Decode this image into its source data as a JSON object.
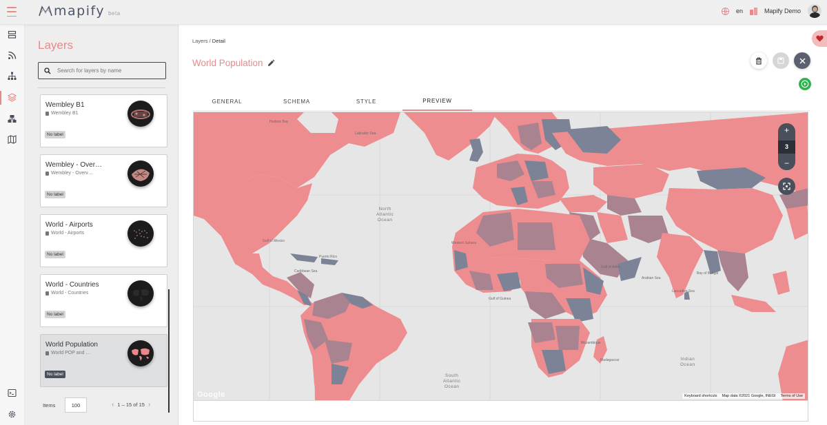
{
  "app": {
    "logo_text": "mapify",
    "logo_badge": "beta",
    "language": "en",
    "org_name": "Mapify Demo"
  },
  "rail": {
    "icons": [
      "datasets-icon",
      "rss-icon",
      "hierarchy-icon",
      "layers-icon",
      "sitemap-icon",
      "map-icon",
      "terminal-icon",
      "settings-icon"
    ],
    "active": "layers-icon"
  },
  "layers_panel": {
    "title": "Layers",
    "search_placeholder": "Search for layers by name",
    "cards": [
      {
        "title": "Wembley B1",
        "source": "Wembley B1",
        "label": "No label"
      },
      {
        "title": "Wembley - Over…",
        "source": "Wembley - Overv…",
        "label": "No label"
      },
      {
        "title": "World - Airports",
        "source": "World - Airports",
        "label": "No label"
      },
      {
        "title": "World - Countries",
        "source": "World - Countries",
        "label": "No label"
      },
      {
        "title": "World Population",
        "source": "World POP and …",
        "label": "No label"
      }
    ],
    "selected_index": 4,
    "items_label": "Items",
    "items_value": "100",
    "range_text": "1 – 15 of 15"
  },
  "detail": {
    "breadcrumb_root": "Layers",
    "breadcrumb_sep": " / ",
    "breadcrumb_current": "Detail",
    "title": "World Population",
    "tabs": [
      "GENERAL",
      "SCHEMA",
      "STYLE",
      "PREVIEW"
    ],
    "active_tab": "PREVIEW"
  },
  "map": {
    "zoom_level": "3",
    "zoom_in": "+",
    "zoom_out": "−",
    "oceans": {
      "north_atlantic": "North\nAtlantic\nOcean",
      "south_atlantic": "South\nAtlantic\nOcean",
      "indian": "Indian\nOcean"
    },
    "seas": [
      "Hudson Bay",
      "Labrador Sea",
      "Gulf of Mexico",
      "Caribbean Sea",
      "Puerto Rico",
      "Gulf of Guinea",
      "Gulf of Aden",
      "Arabian Sea",
      "Bay of Bengal",
      "Laccadive Sea",
      "Western Sahara",
      "Madagascar",
      "Mozambique"
    ],
    "logo_watermark": "Google",
    "credits": [
      "Keyboard shortcuts",
      "Map data ©2021 Google, INEGI",
      "Terms of Use"
    ],
    "colors": {
      "land_pink": "#ee8d8f",
      "land_mauve": "#a98390",
      "land_slate": "#7d8396",
      "water": "#e6e6e6"
    }
  },
  "colors": {
    "accent": "#e88a8a",
    "dark": "#4a4f5c",
    "success": "#2fb34f"
  }
}
